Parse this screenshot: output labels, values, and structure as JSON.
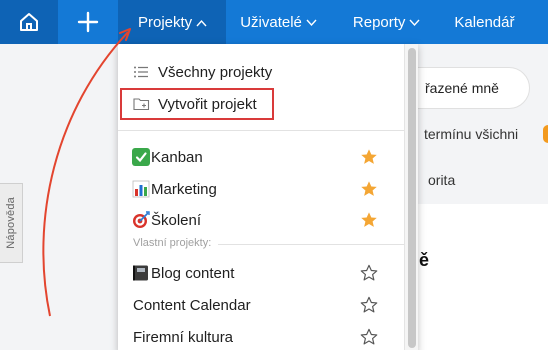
{
  "nav": {
    "items": [
      {
        "label": "Projekty",
        "active": true
      },
      {
        "label": "Uživatelé"
      },
      {
        "label": "Reporty"
      },
      {
        "label": "Kalendář"
      }
    ]
  },
  "background": {
    "pill_text": "řazené mně",
    "text1": "termínu všichni",
    "text2": "orita",
    "heading": "ě",
    "help_tab": "Nápověda"
  },
  "dropdown": {
    "all_projects": "Všechny projekty",
    "create_project": "Vytvořit projekt",
    "favorites": [
      {
        "label": "Kanban",
        "icon": "check-emoji-icon",
        "starred": true
      },
      {
        "label": "Marketing",
        "icon": "bar-chart-emoji-icon",
        "starred": true
      },
      {
        "label": "Školení",
        "icon": "dart-emoji-icon",
        "starred": true
      }
    ],
    "section_own": "Vlastní projekty:",
    "own": [
      {
        "label": "Blog content",
        "icon": "notebook-emoji-icon",
        "starred": false
      },
      {
        "label": "Content Calendar",
        "starred": false
      },
      {
        "label": "Firemní kultura",
        "starred": false
      }
    ]
  },
  "colors": {
    "nav_bg": "#1479d6",
    "nav_active": "#0e63b5",
    "star_filled": "#f4a634",
    "highlight_border": "#d93a3a",
    "annotation_arrow": "#e3452f"
  }
}
